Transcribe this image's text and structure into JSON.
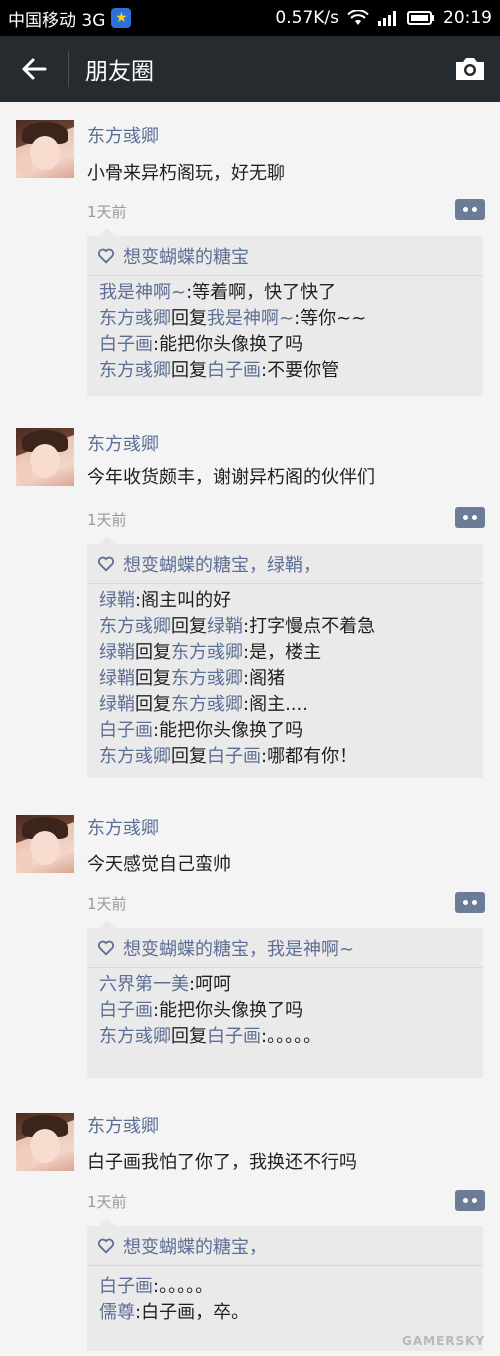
{
  "status_bar": {
    "carrier": "中国移动 3G",
    "speed": "0.57K/s",
    "time": "20:19"
  },
  "header": {
    "title": "朋友圈"
  },
  "posts": [
    {
      "author": "东方彧卿",
      "text": "小骨来异朽阁玩，好无聊",
      "time": "1天前",
      "likes": "想变蝴蝶的糖宝",
      "comments": [
        {
          "from": "我是神啊~",
          "reply_word": "",
          "to": "",
          "sep": ":",
          "text": "等着啊，快了快了"
        },
        {
          "from": "东方彧卿",
          "reply_word": "回复",
          "to": "我是神啊~",
          "sep": ":",
          "text": "等你~~"
        },
        {
          "from": "白子画",
          "reply_word": "",
          "to": "",
          "sep": ":",
          "text": "能把你头像换了吗"
        },
        {
          "from": "东方彧卿",
          "reply_word": "回复",
          "to": "白子画",
          "sep": ":",
          "text": "不要你管"
        }
      ]
    },
    {
      "author": "东方彧卿",
      "text": "今年收货颇丰，谢谢异朽阁的伙伴们",
      "time": "1天前",
      "likes": "想变蝴蝶的糖宝，绿鞘，",
      "comments": [
        {
          "from": "绿鞘",
          "reply_word": "",
          "to": "",
          "sep": ":",
          "text": "阁主叫的好"
        },
        {
          "from": "东方彧卿",
          "reply_word": "回复",
          "to": "绿鞘",
          "sep": ":",
          "text": "打字慢点不着急"
        },
        {
          "from": "绿鞘",
          "reply_word": "回复",
          "to": "东方彧卿",
          "sep": ":",
          "text": "是，楼主"
        },
        {
          "from": "绿鞘",
          "reply_word": "回复",
          "to": "东方彧卿",
          "sep": ":",
          "text": "阁猪"
        },
        {
          "from": "绿鞘",
          "reply_word": "回复",
          "to": "东方彧卿",
          "sep": ":",
          "text": "阁主...."
        },
        {
          "from": "白子画",
          "reply_word": "",
          "to": "",
          "sep": ":",
          "text": "能把你头像换了吗"
        },
        {
          "from": "东方彧卿",
          "reply_word": "回复",
          "to": "白子画",
          "sep": ":",
          "text": "哪都有你！"
        }
      ]
    },
    {
      "author": "东方彧卿",
      "text": "今天感觉自己蛮帅",
      "time": "1天前",
      "likes": "想变蝴蝶的糖宝，我是神啊~",
      "comments": [
        {
          "from": "六界第一美",
          "reply_word": "",
          "to": "",
          "sep": ":",
          "text": "呵呵"
        },
        {
          "from": "白子画",
          "reply_word": "",
          "to": "",
          "sep": ":",
          "text": "能把你头像换了吗"
        },
        {
          "from": "东方彧卿",
          "reply_word": "回复",
          "to": "白子画",
          "sep": ":",
          "text": "。。。。。"
        }
      ]
    },
    {
      "author": "东方彧卿",
      "text": "白子画我怕了你了，我换还不行吗",
      "time": "1天前",
      "likes": "想变蝴蝶的糖宝，",
      "comments": [
        {
          "from": "白子画",
          "reply_word": "",
          "to": "",
          "sep": ":",
          "text": "。。。。。"
        },
        {
          "from": "儒尊",
          "reply_word": "",
          "to": "",
          "sep": ":",
          "text": "白子画，卒。"
        }
      ]
    }
  ],
  "watermark": "GAMERSKY",
  "colors": {
    "name_link": "#5d6f95",
    "titlebar": "#262b2f",
    "panel": "#eaeaea"
  }
}
